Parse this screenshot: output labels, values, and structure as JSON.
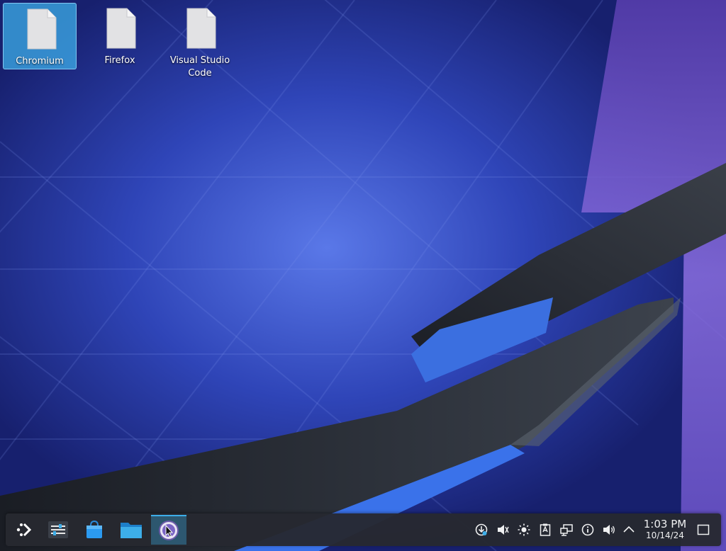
{
  "desktop": {
    "icons": [
      {
        "label": "Chromium",
        "icon": "file-icon",
        "selected": true
      },
      {
        "label": "Firefox",
        "icon": "file-icon",
        "selected": false
      },
      {
        "label": "Visual Studio Code",
        "icon": "file-icon",
        "selected": false
      }
    ],
    "wallpaper": "blue-plasma-abstract"
  },
  "taskbar": {
    "launcher_icon": "kde-application-launcher-icon",
    "tasks": [
      {
        "icon": "system-settings-icon"
      },
      {
        "icon": "discover-store-icon"
      },
      {
        "icon": "dolphin-folder-icon"
      },
      {
        "icon": "app-icon",
        "active": true
      }
    ],
    "tray": [
      {
        "icon": "updates-icon"
      },
      {
        "icon": "volume-muted-icon"
      },
      {
        "icon": "brightness-icon"
      },
      {
        "icon": "clipboard-icon"
      },
      {
        "icon": "network-icon"
      },
      {
        "icon": "info-icon"
      },
      {
        "icon": "volume-icon"
      },
      {
        "icon": "chevron-up-icon"
      }
    ],
    "clock": {
      "time": "1:03 PM",
      "date": "10/14/24"
    },
    "show_desktop_icon": "show-desktop-icon"
  },
  "colors": {
    "accent": "#3daee9",
    "panel": "#262930",
    "wallpaper_base": "#1f2a8a"
  }
}
